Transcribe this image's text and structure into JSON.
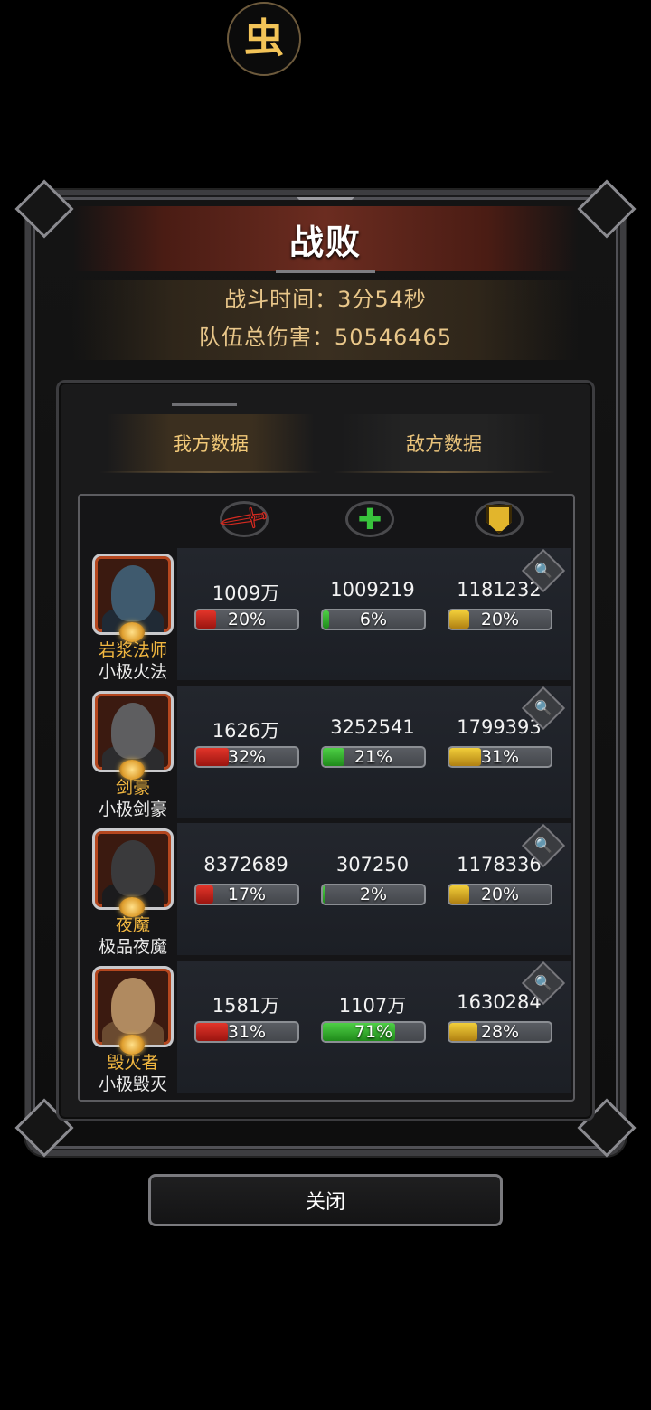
{
  "top_badge": {
    "glyph": "虫",
    "icon": "bug-logo-icon"
  },
  "result": {
    "title": "战败",
    "battle_time_label": "战斗时间：",
    "battle_time_value": "3分54秒",
    "team_damage_label": "队伍总伤害：",
    "team_damage_value": "50546465"
  },
  "tabs": [
    {
      "label": "我方数据",
      "active": true
    },
    {
      "label": "敌方数据",
      "active": false
    }
  ],
  "columns": [
    {
      "name": "damage",
      "icon": "sword-icon",
      "color": "#d42a20"
    },
    {
      "name": "healing",
      "icon": "heal-plus-icon",
      "color": "#38c23c"
    },
    {
      "name": "damage-taken",
      "icon": "shield-icon",
      "color": "#e2b52c"
    }
  ],
  "heroes": [
    {
      "class": "岩浆法师",
      "name": "小极火法",
      "damage": "1009万",
      "damage_pct": "20%",
      "damage_fill": 0.2,
      "heal": "1009219",
      "heal_pct": "6%",
      "heal_fill": 0.06,
      "taken": "1181232",
      "taken_pct": "20%",
      "taken_fill": 0.2,
      "portrait_colors": [
        "#3f5a6e",
        "#202a35"
      ]
    },
    {
      "class": "剑豪",
      "name": "小极剑豪",
      "damage": "1626万",
      "damage_pct": "32%",
      "damage_fill": 0.32,
      "heal": "3252541",
      "heal_pct": "21%",
      "heal_fill": 0.21,
      "taken": "1799393",
      "taken_pct": "31%",
      "taken_fill": 0.31,
      "portrait_colors": [
        "#5e5e60",
        "#2c2c2e"
      ]
    },
    {
      "class": "夜魔",
      "name": "极品夜魔",
      "damage": "8372689",
      "damage_pct": "17%",
      "damage_fill": 0.17,
      "heal": "307250",
      "heal_pct": "2%",
      "heal_fill": 0.02,
      "taken": "1178336",
      "taken_pct": "20%",
      "taken_fill": 0.2,
      "portrait_colors": [
        "#3a3a3c",
        "#1b1b1d"
      ]
    },
    {
      "class": "毁灭者",
      "name": "小极毁灭",
      "damage": "1581万",
      "damage_pct": "31%",
      "damage_fill": 0.31,
      "heal": "1107万",
      "heal_pct": "71%",
      "heal_fill": 0.71,
      "taken": "1630284",
      "taken_pct": "28%",
      "taken_fill": 0.28,
      "portrait_colors": [
        "#b08a60",
        "#6a4a30"
      ]
    }
  ],
  "close_button": {
    "label": "关闭"
  }
}
